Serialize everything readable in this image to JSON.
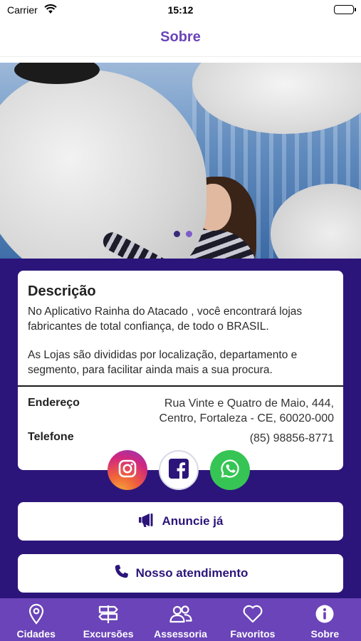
{
  "status_bar": {
    "carrier": "Carrier",
    "time": "15:12"
  },
  "header": {
    "title": "Sobre"
  },
  "hero": {
    "slide_count": 2,
    "active_slide": 2
  },
  "description": {
    "title": "Descrição",
    "paragraph1": "No Aplicativo Rainha do Atacado , você encontrará lojas fabricantes de total confiança, de todo o BRASIL.",
    "paragraph2": "As Lojas são divididas por localização, departamento e segmento, para facilitar ainda mais a sua procura."
  },
  "contact": {
    "address_label": "Endereço",
    "address_line1": "Rua Vinte e Quatro de Maio, 444,",
    "address_line2": "Centro, Fortaleza - CE, 60020-000",
    "phone_label": "Telefone",
    "phone_value": "(85) 98856-8771"
  },
  "social": [
    "instagram-icon",
    "facebook-icon",
    "whatsapp-icon"
  ],
  "buttons": {
    "anuncie": "Anuncie já",
    "atendimento": "Nosso atendimento"
  },
  "tabs": [
    {
      "label": "Cidades",
      "icon": "location-pin-icon"
    },
    {
      "label": "Excursões",
      "icon": "signpost-icon"
    },
    {
      "label": "Assessoria",
      "icon": "users-icon"
    },
    {
      "label": "Favoritos",
      "icon": "heart-icon"
    },
    {
      "label": "Sobre",
      "icon": "info-icon",
      "active": true
    }
  ],
  "colors": {
    "brand_purple": "#6a44b8",
    "deep_purple": "#2c157a",
    "whatsapp_green": "#36c554"
  }
}
